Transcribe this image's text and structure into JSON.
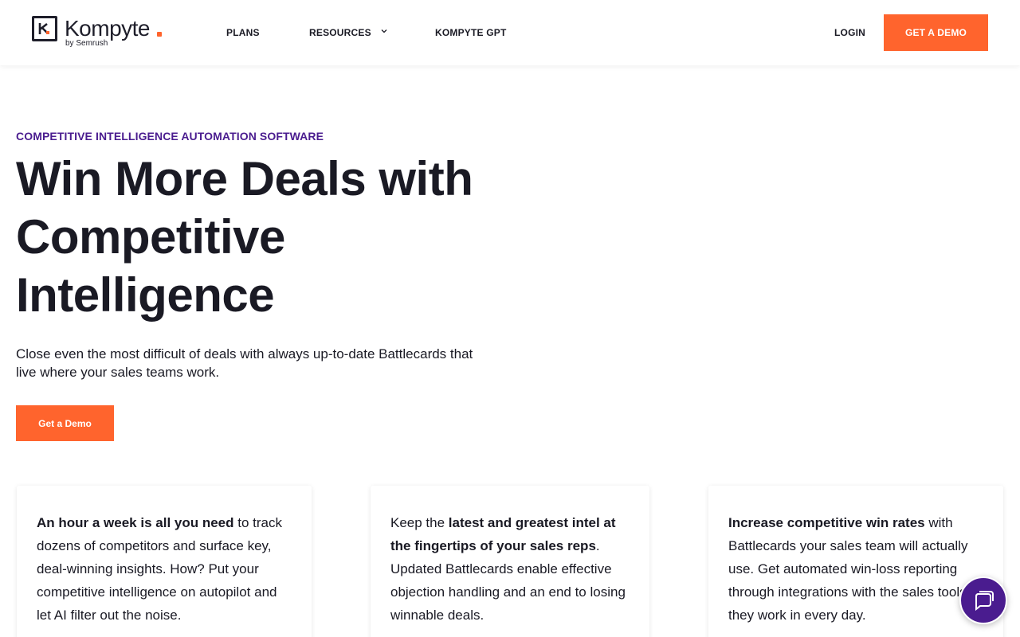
{
  "brand": {
    "name": "Kompyte",
    "sub": "by Semrush",
    "accent": "#ff642d",
    "purple": "#4a1c8f"
  },
  "nav": {
    "plans": "PLANS",
    "resources": "RESOURCES",
    "gpt": "KOMPYTE GPT",
    "login": "LOGIN",
    "demo": "GET A DEMO"
  },
  "hero": {
    "eyebrow": "COMPETITIVE INTELLIGENCE AUTOMATION SOFTWARE",
    "headline": "Win More Deals with Competitive Intelligence",
    "subtext": "Close even the most difficult of deals with always up-to-date Battlecards that live where your sales teams work.",
    "cta": "Get a Demo"
  },
  "cards": [
    {
      "bold": "An hour a week is all you need",
      "rest": " to track dozens of competitors and surface key, deal-winning insights. How? Put your competitive intelligence on autopilot and let AI filter out the noise."
    },
    {
      "pre": "Keep the ",
      "bold": "latest and greatest intel at the fingertips of your sales reps",
      "rest": ". Updated Battlecards enable effective objection handling and an end to losing winnable deals."
    },
    {
      "bold": "Increase competitive win rates",
      "rest": " with Battlecards your sales team will actually use. Get automated win-loss reporting through integrations with the sales tools they work in every day."
    }
  ],
  "icons": {
    "logo": "kompyte-logo-icon",
    "chevron": "chevron-down-icon",
    "chat": "chat-icon"
  }
}
